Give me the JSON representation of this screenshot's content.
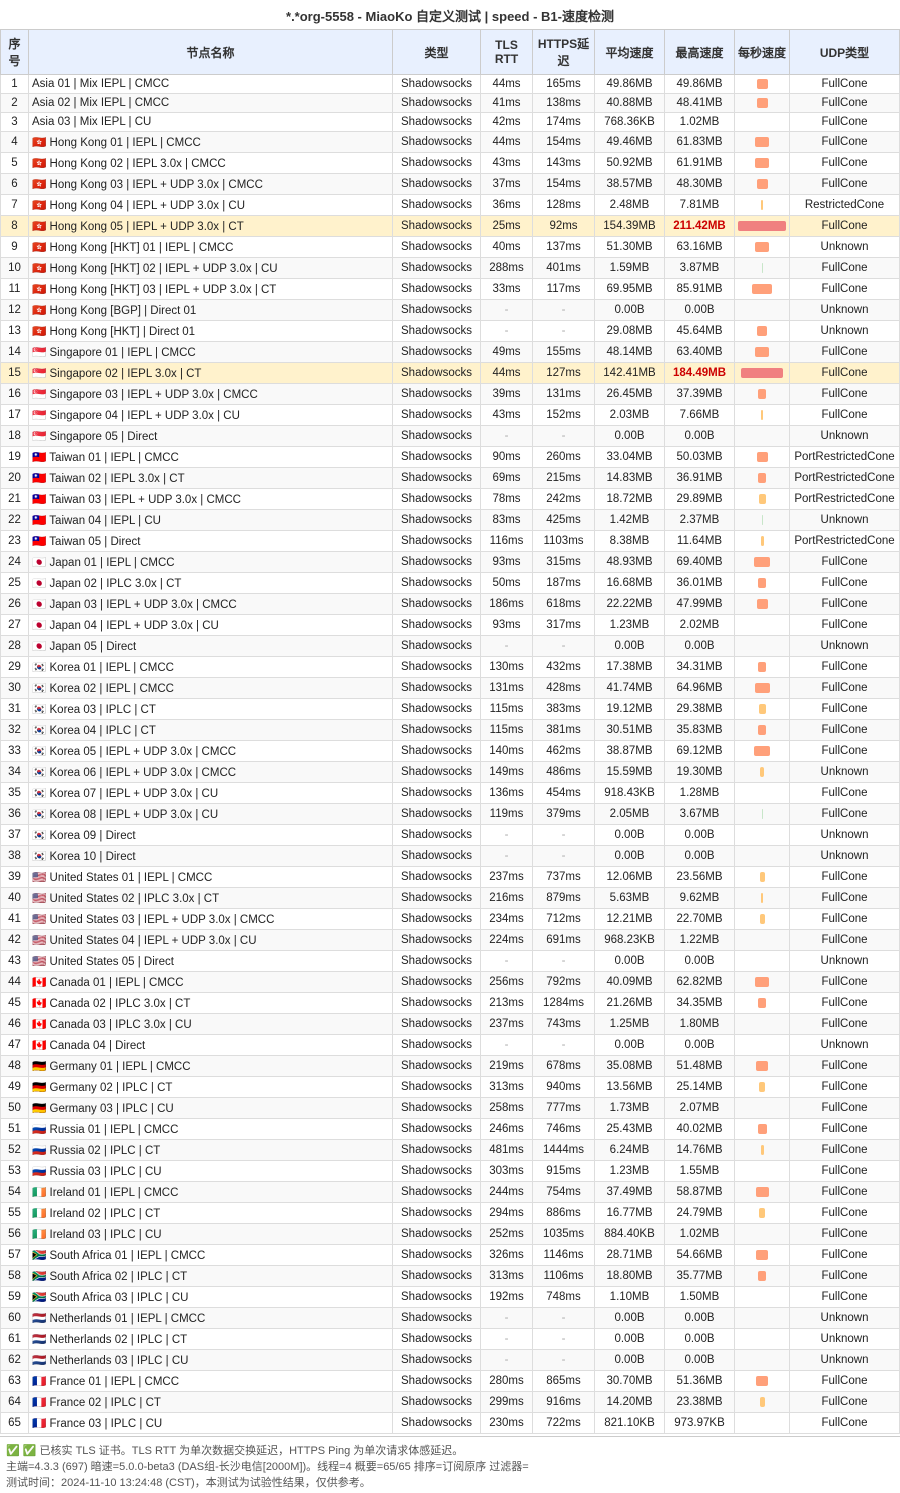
{
  "title": "*.*org-5558 - MiaoKo 自定义测试 | speed - B1-速度检测",
  "columns": [
    "序号",
    "节点名称",
    "类型",
    "TLS RTT",
    "HTTPS延迟",
    "平均速度",
    "最高速度",
    "每秒速度",
    "UDP类型"
  ],
  "rows": [
    [
      1,
      "Asia 01 | Mix IEPL | CMCC",
      "Shadowsocks",
      "44ms",
      "165ms",
      "49.86MB",
      "49.86MB",
      "",
      "FullCone"
    ],
    [
      2,
      "Asia 02 | Mix IEPL | CMCC",
      "Shadowsocks",
      "41ms",
      "138ms",
      "40.88MB",
      "48.41MB",
      "",
      "FullCone"
    ],
    [
      3,
      "Asia 03 | Mix IEPL | CU",
      "Shadowsocks",
      "42ms",
      "174ms",
      "768.36KB",
      "1.02MB",
      "",
      "FullCone"
    ],
    [
      4,
      "🇭🇰 Hong Kong 01 | IEPL | CMCC",
      "Shadowsocks",
      "44ms",
      "154ms",
      "49.46MB",
      "61.83MB",
      "",
      "FullCone"
    ],
    [
      5,
      "🇭🇰 Hong Kong 02 | IEPL 3.0x | CMCC",
      "Shadowsocks",
      "43ms",
      "143ms",
      "50.92MB",
      "61.91MB",
      "",
      "FullCone"
    ],
    [
      6,
      "🇭🇰 Hong Kong 03 | IEPL + UDP 3.0x | CMCC",
      "Shadowsocks",
      "37ms",
      "154ms",
      "38.57MB",
      "48.30MB",
      "",
      "FullCone"
    ],
    [
      7,
      "🇭🇰 Hong Kong 04 | IEPL + UDP 3.0x | CU",
      "Shadowsocks",
      "36ms",
      "128ms",
      "2.48MB",
      "7.81MB",
      "",
      "RestrictedCone"
    ],
    [
      8,
      "🇭🇰 Hong Kong 05 | IEPL + UDP 3.0x | CT",
      "Shadowsocks",
      "25ms",
      "92ms",
      "154.39MB",
      "211.42MB",
      "",
      "FullCone"
    ],
    [
      9,
      "🇭🇰 Hong Kong [HKT] 01 | IEPL | CMCC",
      "Shadowsocks",
      "40ms",
      "137ms",
      "51.30MB",
      "63.16MB",
      "",
      "Unknown"
    ],
    [
      10,
      "🇭🇰 Hong Kong [HKT] 02 | IEPL + UDP 3.0x | CU",
      "Shadowsocks",
      "288ms",
      "401ms",
      "1.59MB",
      "3.87MB",
      "",
      "FullCone"
    ],
    [
      11,
      "🇭🇰 Hong Kong [HKT] 03 | IEPL + UDP 3.0x | CT",
      "Shadowsocks",
      "33ms",
      "117ms",
      "69.95MB",
      "85.91MB",
      "",
      "FullCone"
    ],
    [
      12,
      "🇭🇰 Hong Kong [BGP] | Direct 01",
      "Shadowsocks",
      "-",
      "-",
      "0.00B",
      "0.00B",
      "",
      "Unknown"
    ],
    [
      13,
      "🇭🇰 Hong Kong [HKT] | Direct 01",
      "Shadowsocks",
      "-",
      "-",
      "29.08MB",
      "45.64MB",
      "",
      "Unknown"
    ],
    [
      14,
      "🇸🇬 Singapore 01 | IEPL | CMCC",
      "Shadowsocks",
      "49ms",
      "155ms",
      "48.14MB",
      "63.40MB",
      "",
      "FullCone"
    ],
    [
      15,
      "🇸🇬 Singapore 02 | IEPL 3.0x | CT",
      "Shadowsocks",
      "44ms",
      "127ms",
      "142.41MB",
      "184.49MB",
      "",
      "FullCone"
    ],
    [
      16,
      "🇸🇬 Singapore 03 | IEPL + UDP 3.0x | CMCC",
      "Shadowsocks",
      "39ms",
      "131ms",
      "26.45MB",
      "37.39MB",
      "",
      "FullCone"
    ],
    [
      17,
      "🇸🇬 Singapore 04 | IEPL + UDP 3.0x | CU",
      "Shadowsocks",
      "43ms",
      "152ms",
      "2.03MB",
      "7.66MB",
      "",
      "FullCone"
    ],
    [
      18,
      "🇸🇬 Singapore 05 | Direct",
      "Shadowsocks",
      "-",
      "-",
      "0.00B",
      "0.00B",
      "",
      "Unknown"
    ],
    [
      19,
      "🇹🇼 Taiwan 01 | IEPL | CMCC",
      "Shadowsocks",
      "90ms",
      "260ms",
      "33.04MB",
      "50.03MB",
      "",
      "PortRestrictedCone"
    ],
    [
      20,
      "🇹🇼 Taiwan 02 | IEPL 3.0x | CT",
      "Shadowsocks",
      "69ms",
      "215ms",
      "14.83MB",
      "36.91MB",
      "",
      "PortRestrictedCone"
    ],
    [
      21,
      "🇹🇼 Taiwan 03 | IEPL + UDP 3.0x | CMCC",
      "Shadowsocks",
      "78ms",
      "242ms",
      "18.72MB",
      "29.89MB",
      "",
      "PortRestrictedCone"
    ],
    [
      22,
      "🇹🇼 Taiwan 04 | IEPL | CU",
      "Shadowsocks",
      "83ms",
      "425ms",
      "1.42MB",
      "2.37MB",
      "",
      "Unknown"
    ],
    [
      23,
      "🇹🇼 Taiwan 05 | Direct",
      "Shadowsocks",
      "116ms",
      "1103ms",
      "8.38MB",
      "11.64MB",
      "",
      "PortRestrictedCone"
    ],
    [
      24,
      "🇯🇵 Japan 01 | IEPL | CMCC",
      "Shadowsocks",
      "93ms",
      "315ms",
      "48.93MB",
      "69.40MB",
      "",
      "FullCone"
    ],
    [
      25,
      "🇯🇵 Japan 02 | IPLC 3.0x | CT",
      "Shadowsocks",
      "50ms",
      "187ms",
      "16.68MB",
      "36.01MB",
      "",
      "FullCone"
    ],
    [
      26,
      "🇯🇵 Japan 03 | IEPL + UDP 3.0x | CMCC",
      "Shadowsocks",
      "186ms",
      "618ms",
      "22.22MB",
      "47.99MB",
      "",
      "FullCone"
    ],
    [
      27,
      "🇯🇵 Japan 04 | IEPL + UDP 3.0x | CU",
      "Shadowsocks",
      "93ms",
      "317ms",
      "1.23MB",
      "2.02MB",
      "",
      "FullCone"
    ],
    [
      28,
      "🇯🇵 Japan 05 | Direct",
      "Shadowsocks",
      "-",
      "-",
      "0.00B",
      "0.00B",
      "",
      "Unknown"
    ],
    [
      29,
      "🇰🇷 Korea  01 | IEPL | CMCC",
      "Shadowsocks",
      "130ms",
      "432ms",
      "17.38MB",
      "34.31MB",
      "",
      "FullCone"
    ],
    [
      30,
      "🇰🇷 Korea  02 | IEPL | CMCC",
      "Shadowsocks",
      "131ms",
      "428ms",
      "41.74MB",
      "64.96MB",
      "",
      "FullCone"
    ],
    [
      31,
      "🇰🇷 Korea  03 | IPLC | CT",
      "Shadowsocks",
      "115ms",
      "383ms",
      "19.12MB",
      "29.38MB",
      "",
      "FullCone"
    ],
    [
      32,
      "🇰🇷 Korea  04 | IPLC | CT",
      "Shadowsocks",
      "115ms",
      "381ms",
      "30.51MB",
      "35.83MB",
      "",
      "FullCone"
    ],
    [
      33,
      "🇰🇷 Korea  05 | IEPL + UDP 3.0x | CMCC",
      "Shadowsocks",
      "140ms",
      "462ms",
      "38.87MB",
      "69.12MB",
      "",
      "FullCone"
    ],
    [
      34,
      "🇰🇷 Korea  06 | IEPL + UDP 3.0x | CMCC",
      "Shadowsocks",
      "149ms",
      "486ms",
      "15.59MB",
      "19.30MB",
      "",
      "Unknown"
    ],
    [
      35,
      "🇰🇷 Korea  07 | IEPL + UDP 3.0x | CU",
      "Shadowsocks",
      "136ms",
      "454ms",
      "918.43KB",
      "1.28MB",
      "",
      "FullCone"
    ],
    [
      36,
      "🇰🇷 Korea  08 | IEPL + UDP 3.0x | CU",
      "Shadowsocks",
      "119ms",
      "379ms",
      "2.05MB",
      "3.67MB",
      "",
      "FullCone"
    ],
    [
      37,
      "🇰🇷 Korea  09 | Direct",
      "Shadowsocks",
      "-",
      "-",
      "0.00B",
      "0.00B",
      "",
      "Unknown"
    ],
    [
      38,
      "🇰🇷 Korea  10 | Direct",
      "Shadowsocks",
      "-",
      "-",
      "0.00B",
      "0.00B",
      "",
      "Unknown"
    ],
    [
      39,
      "🇺🇸 United States 01 | IEPL | CMCC",
      "Shadowsocks",
      "237ms",
      "737ms",
      "12.06MB",
      "23.56MB",
      "",
      "FullCone"
    ],
    [
      40,
      "🇺🇸 United States 02 | IPLC 3.0x | CT",
      "Shadowsocks",
      "216ms",
      "879ms",
      "5.63MB",
      "9.62MB",
      "",
      "FullCone"
    ],
    [
      41,
      "🇺🇸 United States 03 | IEPL + UDP 3.0x | CMCC",
      "Shadowsocks",
      "234ms",
      "712ms",
      "12.21MB",
      "22.70MB",
      "",
      "FullCone"
    ],
    [
      42,
      "🇺🇸 United States 04 | IEPL + UDP 3.0x | CU",
      "Shadowsocks",
      "224ms",
      "691ms",
      "968.23KB",
      "1.22MB",
      "",
      "FullCone"
    ],
    [
      43,
      "🇺🇸 United States 05 | Direct",
      "Shadowsocks",
      "-",
      "-",
      "0.00B",
      "0.00B",
      "",
      "Unknown"
    ],
    [
      44,
      "🇨🇦 Canada 01 | IEPL | CMCC",
      "Shadowsocks",
      "256ms",
      "792ms",
      "40.09MB",
      "62.82MB",
      "",
      "FullCone"
    ],
    [
      45,
      "🇨🇦 Canada 02 | IPLC 3.0x | CT",
      "Shadowsocks",
      "213ms",
      "1284ms",
      "21.26MB",
      "34.35MB",
      "",
      "FullCone"
    ],
    [
      46,
      "🇨🇦 Canada 03 | IPLC 3.0x | CU",
      "Shadowsocks",
      "237ms",
      "743ms",
      "1.25MB",
      "1.80MB",
      "",
      "FullCone"
    ],
    [
      47,
      "🇨🇦 Canada 04 | Direct",
      "Shadowsocks",
      "-",
      "-",
      "0.00B",
      "0.00B",
      "",
      "Unknown"
    ],
    [
      48,
      "🇩🇪 Germany 01 | IEPL | CMCC",
      "Shadowsocks",
      "219ms",
      "678ms",
      "35.08MB",
      "51.48MB",
      "",
      "FullCone"
    ],
    [
      49,
      "🇩🇪 Germany 02 | IPLC | CT",
      "Shadowsocks",
      "313ms",
      "940ms",
      "13.56MB",
      "25.14MB",
      "",
      "FullCone"
    ],
    [
      50,
      "🇩🇪 Germany 03 | IPLC | CU",
      "Shadowsocks",
      "258ms",
      "777ms",
      "1.73MB",
      "2.07MB",
      "",
      "FullCone"
    ],
    [
      51,
      "🇷🇺 Russia 01 | IEPL | CMCC",
      "Shadowsocks",
      "246ms",
      "746ms",
      "25.43MB",
      "40.02MB",
      "",
      "FullCone"
    ],
    [
      52,
      "🇷🇺 Russia 02 | IPLC | CT",
      "Shadowsocks",
      "481ms",
      "1444ms",
      "6.24MB",
      "14.76MB",
      "",
      "FullCone"
    ],
    [
      53,
      "🇷🇺 Russia 03 | IPLC | CU",
      "Shadowsocks",
      "303ms",
      "915ms",
      "1.23MB",
      "1.55MB",
      "",
      "FullCone"
    ],
    [
      54,
      "🇮🇪 Ireland 01 | IEPL | CMCC",
      "Shadowsocks",
      "244ms",
      "754ms",
      "37.49MB",
      "58.87MB",
      "",
      "FullCone"
    ],
    [
      55,
      "🇮🇪 Ireland 02 | IPLC | CT",
      "Shadowsocks",
      "294ms",
      "886ms",
      "16.77MB",
      "24.79MB",
      "",
      "FullCone"
    ],
    [
      56,
      "🇮🇪 Ireland 03 | IPLC | CU",
      "Shadowsocks",
      "252ms",
      "1035ms",
      "884.40KB",
      "1.02MB",
      "",
      "FullCone"
    ],
    [
      57,
      "🇿🇦 South Africa 01 | IEPL | CMCC",
      "Shadowsocks",
      "326ms",
      "1146ms",
      "28.71MB",
      "54.66MB",
      "",
      "FullCone"
    ],
    [
      58,
      "🇿🇦 South Africa 02 | IPLC | CT",
      "Shadowsocks",
      "313ms",
      "1106ms",
      "18.80MB",
      "35.77MB",
      "",
      "FullCone"
    ],
    [
      59,
      "🇿🇦 South Africa 03 | IPLC | CU",
      "Shadowsocks",
      "192ms",
      "748ms",
      "1.10MB",
      "1.50MB",
      "",
      "FullCone"
    ],
    [
      60,
      "🇳🇱 Netherlands 01 | IEPL | CMCC",
      "Shadowsocks",
      "-",
      "-",
      "0.00B",
      "0.00B",
      "",
      "Unknown"
    ],
    [
      61,
      "🇳🇱 Netherlands 02 | IPLC | CT",
      "Shadowsocks",
      "-",
      "-",
      "0.00B",
      "0.00B",
      "",
      "Unknown"
    ],
    [
      62,
      "🇳🇱 Netherlands 03 | IPLC | CU",
      "Shadowsocks",
      "-",
      "-",
      "0.00B",
      "0.00B",
      "",
      "Unknown"
    ],
    [
      63,
      "🇫🇷 France 01 | IEPL | CMCC",
      "Shadowsocks",
      "280ms",
      "865ms",
      "30.70MB",
      "51.36MB",
      "",
      "FullCone"
    ],
    [
      64,
      "🇫🇷 France 02 | IPLC | CT",
      "Shadowsocks",
      "299ms",
      "916ms",
      "14.20MB",
      "23.38MB",
      "",
      "FullCone"
    ],
    [
      65,
      "🇫🇷 France 03 | IPLC | CU",
      "Shadowsocks",
      "230ms",
      "722ms",
      "821.10KB",
      "973.97KB",
      "",
      "FullCone"
    ]
  ],
  "footer": {
    "tick_text": "✅ 已核实 TLS 证书。TLS RTT 为单次数据交换延迟，HTTPS Ping 为单次请求体感延迟。",
    "info": "主端=4.3.3 (697) 暗速=5.0.0-beta3 (DAS组-长沙电信[2000M])。线程=4 概要=65/65 排序=订阅原序 过滤器=",
    "time": "测试时间：2024-11-10 13:24:48 (CST)，本测试为试验性结果，仅供参考。"
  },
  "bar_colors": {
    "high": "#f08080",
    "medium": "#ffa07a",
    "low": "#d3d3d3"
  }
}
